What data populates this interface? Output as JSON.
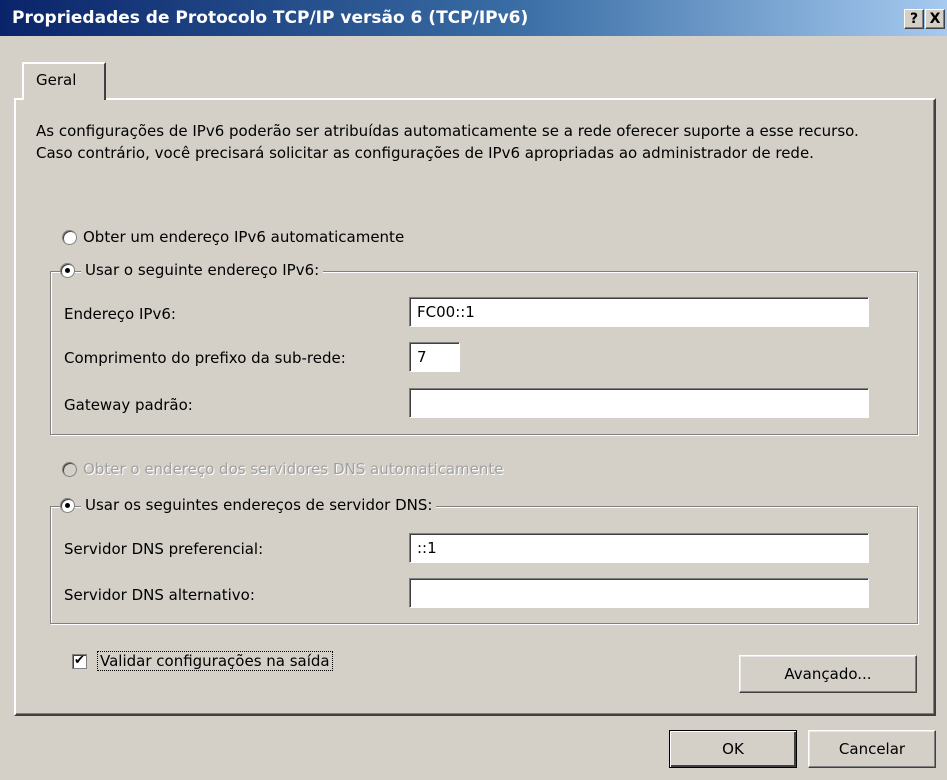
{
  "window": {
    "title": "Propriedades de Protocolo TCP/IP versão 6 (TCP/IPv6)",
    "help_label": "?",
    "close_label": "X"
  },
  "tabs": [
    {
      "label": "Geral",
      "selected": true
    }
  ],
  "intro_text": "As configurações de IPv6 poderão ser atribuídas automaticamente se a rede oferecer suporte a esse recurso. Caso contrário, você precisará solicitar as configurações de IPv6 apropriadas ao administrador de rede.",
  "address": {
    "auto_option": {
      "label": "Obter um endereço IPv6 automaticamente",
      "checked": false
    },
    "manual_option": {
      "label": "Usar o seguinte endereço IPv6:",
      "checked": true
    },
    "fields": {
      "ipv6": {
        "label": "Endereço IPv6:",
        "value": "FC00::1"
      },
      "prefix": {
        "label": "Comprimento do prefixo da sub-rede:",
        "value": "7"
      },
      "gateway": {
        "label": "Gateway padrão:",
        "value": ""
      }
    }
  },
  "dns": {
    "auto_option": {
      "label": "Obter o endereço dos servidores DNS automaticamente",
      "checked": false,
      "disabled": true
    },
    "manual_option": {
      "label": "Usar os seguintes endereços de servidor DNS:",
      "checked": true
    },
    "fields": {
      "preferred": {
        "label": "Servidor DNS preferencial:",
        "value": "::1"
      },
      "alternate": {
        "label": "Servidor DNS alternativo:",
        "value": ""
      }
    }
  },
  "validate": {
    "label": "Validar configurações na saída",
    "checked": true,
    "mark": "✔"
  },
  "buttons": {
    "advanced": "Avançado...",
    "ok": "OK",
    "cancel": "Cancelar"
  }
}
